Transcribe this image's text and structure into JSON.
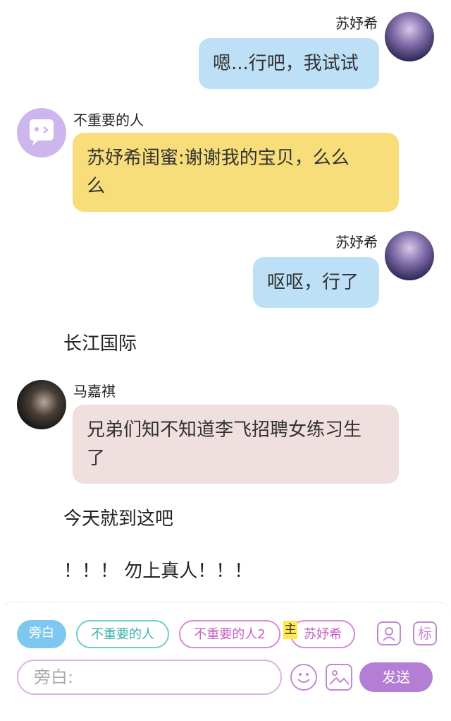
{
  "messages": [
    {
      "speaker": "苏妤希",
      "text": "嗯...行吧，我试试"
    },
    {
      "speaker": "不重要的人",
      "text_line1": "苏妤希闺蜜:谢谢我的宝贝，么么",
      "text_line2": "么"
    },
    {
      "speaker": "苏妤希",
      "text": "呕呕，行了"
    },
    {
      "narration": "长江国际"
    },
    {
      "speaker": "马嘉祺",
      "text_line1": "兄弟们知不知道李飞招聘女练习生",
      "text_line2": "了"
    },
    {
      "narration": "今天就到这吧"
    },
    {
      "narration": "！！！ 勿上真人！！！"
    }
  ],
  "toolbar": {
    "chips": [
      "旁白",
      "不重要的人",
      "不重要的人2",
      "苏妤希"
    ],
    "main_tag": "主",
    "tag_icon_label": "标",
    "input_placeholder": "旁白:",
    "send_label": "发送"
  },
  "colors": {
    "right_bubble": "#bde0f7",
    "yellow_bubble": "#f7de7a",
    "pink_bubble": "#f0dfdf",
    "accent_purple": "#b37ed4",
    "narration_chip": "#7ec8ef",
    "teal_chip": "#6ccfc6",
    "pink_chip": "#d98ad6"
  }
}
